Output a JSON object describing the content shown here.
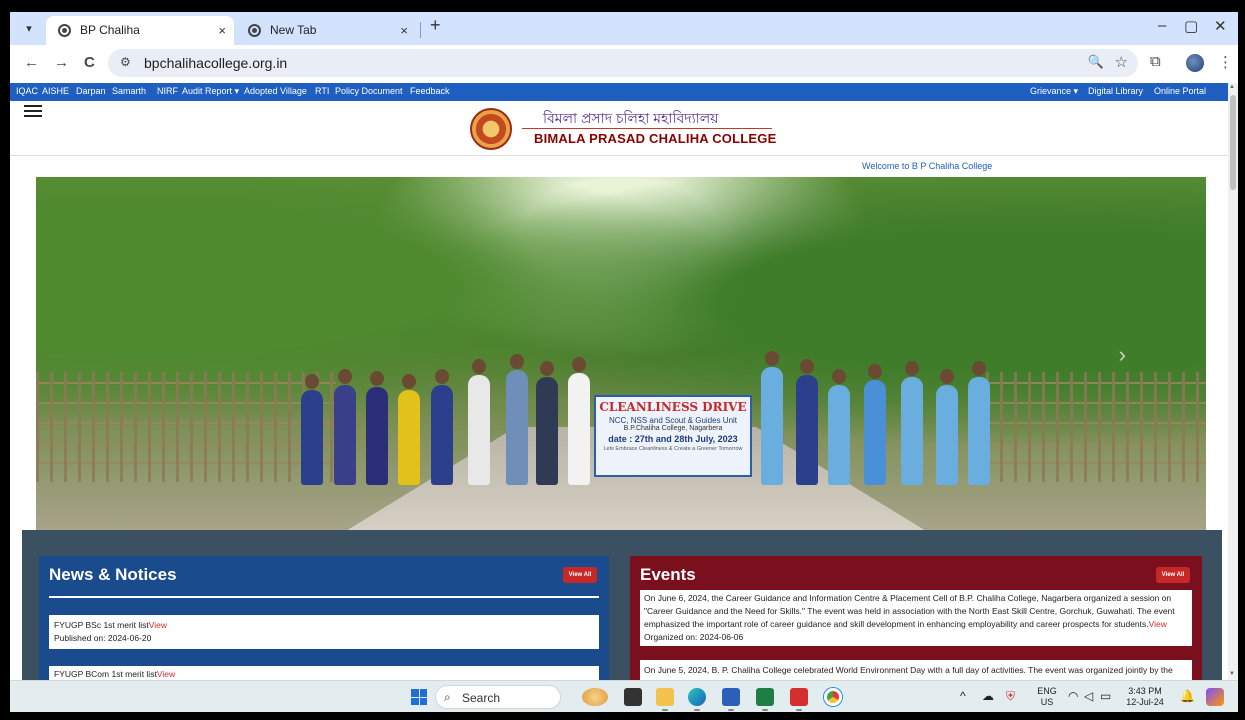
{
  "browser": {
    "tabs": [
      {
        "label": "BP Chaliha",
        "close": "×"
      },
      {
        "label": "New Tab",
        "close": "×"
      }
    ],
    "new_tab": "+",
    "window_controls": {
      "minimize": "–",
      "restore": "▢",
      "close": "✕"
    },
    "nav": {
      "back": "←",
      "forward": "→",
      "reload": "C"
    },
    "url": "bpchalihacollege.org.in",
    "icons": [
      "tune-icon",
      "zoom-icon",
      "star-icon",
      "extensions-icon",
      "profile-avatar",
      "menu-icon"
    ]
  },
  "topmenu": {
    "left": [
      "IQAC",
      "AISHE",
      "Darpan",
      "Samarth",
      "NIRF",
      "Audit Report ▾",
      "Adopted Village",
      "RTI",
      "Policy Document",
      "Feedback"
    ],
    "right": [
      "Grievance ▾",
      "Digital Library",
      "Online Portal"
    ]
  },
  "header": {
    "bengali_name": "বিমলা প্রসাদ চলিহা মহাবিদ্যালয়",
    "english_name": "BIMALA PRASAD CHALIHA COLLEGE"
  },
  "welcome": "Welcome to B P Chaliha College",
  "banner": {
    "line1": "CLEANLINESS DRIVE",
    "line2": "NCC, NSS and Scout & Guides Unit",
    "line3": "B.P.Chaliha College, Nagarbera",
    "line4": "date : 27th and 28th July, 2023",
    "line5": "Lets Embrace Cleanliness & Create a Greener Tomorrow"
  },
  "news": {
    "title": "News & Notices",
    "view_all": "View All",
    "items": [
      {
        "text": "FYUGP BSc 1st merit list",
        "link": "View",
        "published": "Published on: 2024-06-20"
      },
      {
        "text": "FYUGP BCom 1st merit list",
        "link": "View",
        "published": ""
      }
    ]
  },
  "events": {
    "title": "Events",
    "view_all": "View All",
    "items": [
      {
        "text": "On June 6, 2024, the Career Guidance and Information Centre & Placement Cell of B.P. Chaliha College, Nagarbera organized a session on \"Career Guidance and the Need for Skills.\" The event was held in association with the North East Skill Centre, Gorchuk, Guwahati. The event emphasized the important role of career guidance and skill development in enhancing employability and career prospects for students.",
        "link": "View",
        "organized": "Organized on: 2024-06-06"
      },
      {
        "text": "On June 5, 2024, B. P. Chaliha College celebrated World Environment Day with a full day of activities. The event was organized jointly by the",
        "link": "",
        "organized": ""
      }
    ]
  },
  "taskbar": {
    "search": "Search",
    "lang": "ENG",
    "region": "US",
    "time": "3:43 PM",
    "date": "12-Jul-24"
  }
}
